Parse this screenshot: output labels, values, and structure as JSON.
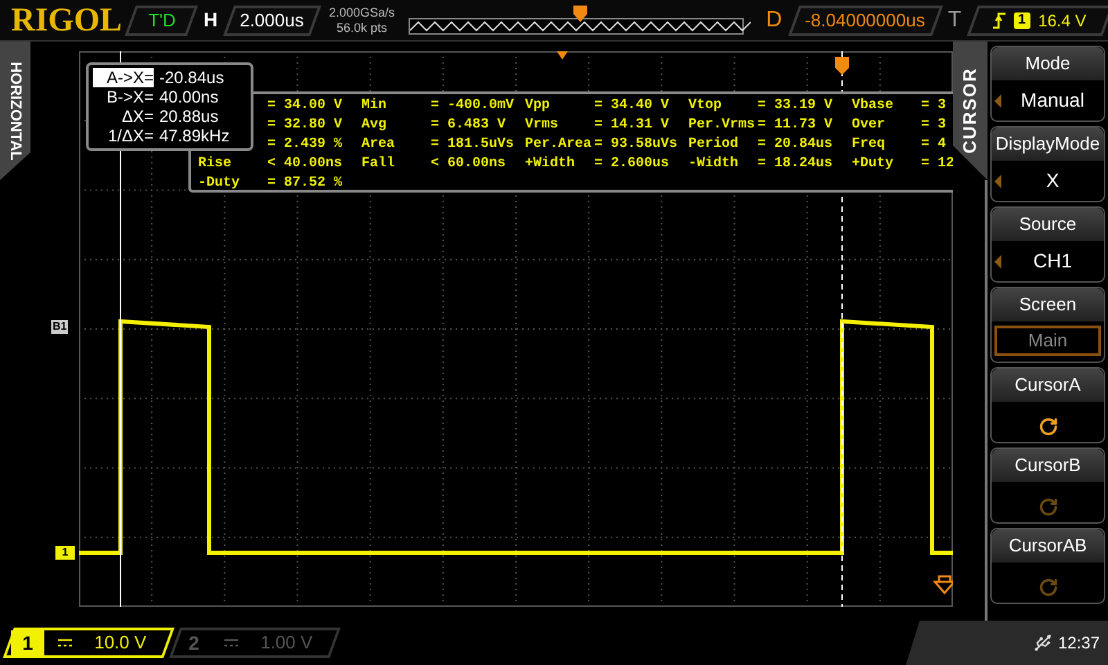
{
  "header": {
    "logo": "RIGOL",
    "run_status": "T'D",
    "timebase_label": "H",
    "timebase": "2.000us",
    "sample_rate": "2.000GSa/s",
    "memory_depth": "56.0k pts",
    "delay_label": "D",
    "delay": "-8.04000000us",
    "trigger_label": "T",
    "trigger_source": "1",
    "trigger_level": "16.4 V"
  },
  "side_tab": "HORIZONTAL",
  "bus_marker": "B1",
  "channel_marker": "1",
  "cursor_readout": [
    {
      "label": "A->X=",
      "value": "-20.84us",
      "selected": true
    },
    {
      "label": "B->X=",
      "value": "40.00ns",
      "selected": false
    },
    {
      "label": "ΔX=",
      "value": "20.88us",
      "selected": false
    },
    {
      "label": "1/ΔX=",
      "value": "47.89kHz",
      "selected": false
    }
  ],
  "measurements": [
    {
      "cells": [
        "= 34.00 V",
        "Min",
        "= -400.0mV",
        "Vpp",
        "= 34.40 V",
        "Vtop",
        "= 33.19 V",
        "Vbase",
        "= 3"
      ]
    },
    {
      "cells": [
        "= 32.80 V",
        "Avg",
        "= 6.483 V",
        "Vrms",
        "= 14.31 V",
        "Per.Vrms",
        "= 11.73 V",
        "Over",
        "= 3"
      ]
    },
    {
      "cells": [
        "= 2.439 %",
        "Area",
        "= 181.5uVs",
        "Per.Area",
        "= 93.58uVs",
        "Period",
        "= 20.84us",
        "Freq",
        "= 4"
      ]
    },
    {
      "label": "Rise",
      "cells": [
        "< 40.00ns",
        "Fall",
        "< 60.00ns",
        "+Width",
        "= 2.600us",
        "-Width",
        "= 18.24us",
        "+Duty",
        "= 12"
      ]
    },
    {
      "label": "-Duty",
      "cells": [
        "= 87.52 %"
      ]
    }
  ],
  "menu": {
    "title": "CURSOR",
    "items": [
      {
        "kind": "select",
        "label": "Mode",
        "value": "Manual"
      },
      {
        "kind": "select",
        "label": "DisplayMode",
        "value": "X"
      },
      {
        "kind": "select",
        "label": "Source",
        "value": "CH1"
      },
      {
        "kind": "boxed",
        "label": "Screen",
        "value": "Main"
      },
      {
        "kind": "knob",
        "label": "CursorA",
        "selected": true
      },
      {
        "kind": "knob",
        "label": "CursorB",
        "selected": false
      },
      {
        "kind": "knob",
        "label": "CursorAB",
        "selected": false
      }
    ]
  },
  "channels": [
    {
      "number": "1",
      "scale": "10.0 V",
      "on": true
    },
    {
      "number": "2",
      "scale": "1.00 V",
      "on": false
    }
  ],
  "status": {
    "time": "12:37"
  }
}
